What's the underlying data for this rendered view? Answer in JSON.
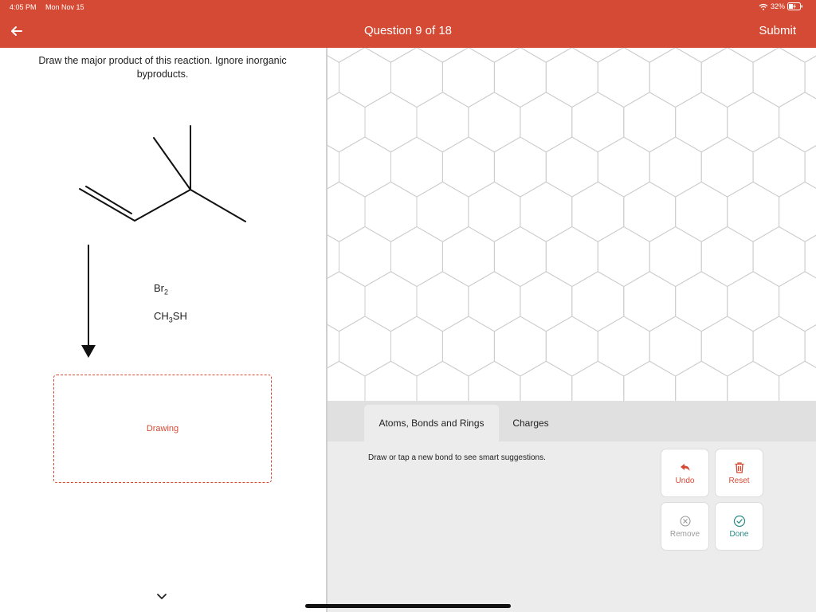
{
  "status_bar": {
    "time": "4:05 PM",
    "date": "Mon Nov 15",
    "battery": "32%"
  },
  "header": {
    "title": "Question 9 of 18",
    "submit_label": "Submit",
    "back_icon": "arrow-left-icon"
  },
  "question": {
    "prompt": "Draw the major product of this reaction. Ignore inorganic byproducts.",
    "reagent_1": {
      "base": "Br",
      "sub": "2",
      "rest": ""
    },
    "reagent_2": {
      "base": "CH",
      "sub": "3",
      "rest": "SH"
    },
    "answer_box_label": "Drawing"
  },
  "toolbar": {
    "tabs": [
      {
        "label": "Atoms, Bonds and Rings",
        "active": true
      },
      {
        "label": "Charges",
        "active": false
      }
    ],
    "hint": "Draw or tap a new bond to see smart suggestions.",
    "buttons": {
      "undo": {
        "label": "Undo",
        "icon": "undo-icon",
        "enabled": true
      },
      "reset": {
        "label": "Reset",
        "icon": "trash-icon",
        "enabled": true
      },
      "remove": {
        "label": "Remove",
        "icon": "x-circle-icon",
        "enabled": false
      },
      "done": {
        "label": "Done",
        "icon": "check-circle-icon",
        "enabled": true
      }
    }
  },
  "colors": {
    "brand": "#d54a34",
    "done": "#2a8a84",
    "disabled": "#9a9a9a",
    "toolbar_bg": "#ececec",
    "tabs_bg": "#e0e0e0",
    "grid_line": "#cccccc"
  }
}
